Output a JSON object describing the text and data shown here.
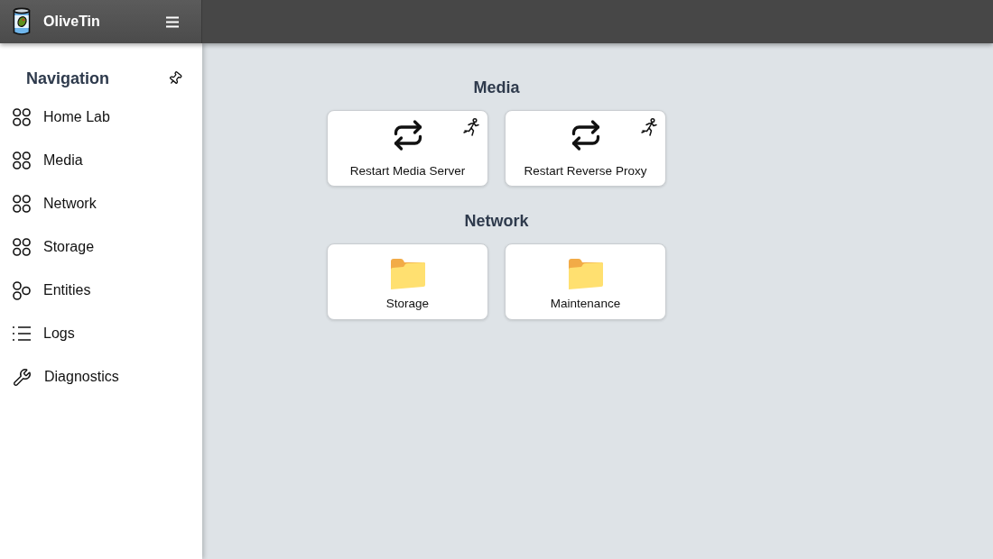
{
  "header": {
    "title": "OliveTin"
  },
  "sidebar": {
    "title": "Navigation",
    "items": [
      {
        "label": "Home Lab",
        "kind": "group",
        "selected": false
      },
      {
        "label": "Media",
        "kind": "group",
        "selected": false
      },
      {
        "label": "Network",
        "kind": "group",
        "selected": false
      },
      {
        "label": "Storage",
        "kind": "group",
        "selected": false
      },
      {
        "label": "Entities",
        "kind": "entities",
        "selected": false
      },
      {
        "label": "Logs",
        "kind": "list",
        "selected": false
      },
      {
        "label": "Diagnostics",
        "kind": "tool",
        "selected": false
      }
    ]
  },
  "sections": [
    {
      "title": "Media",
      "buttons": [
        {
          "label": "Restart Media Server",
          "kind": "action"
        },
        {
          "label": "Restart Reverse Proxy",
          "kind": "action"
        }
      ]
    },
    {
      "title": "Network",
      "buttons": [
        {
          "label": "Storage",
          "kind": "folder"
        },
        {
          "label": "Maintenance",
          "kind": "folder"
        }
      ]
    }
  ]
}
